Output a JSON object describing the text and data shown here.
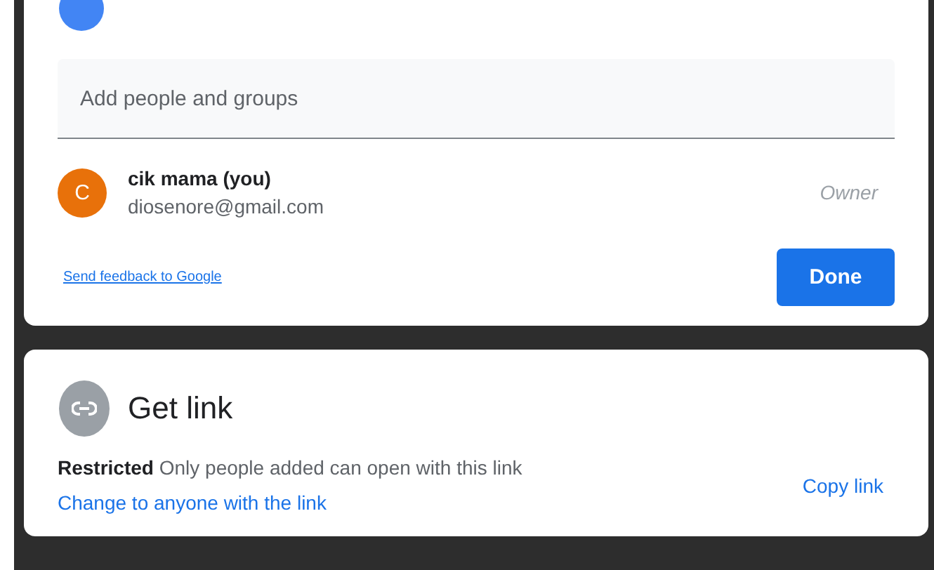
{
  "share_dialog": {
    "search": {
      "placeholder": "Add people and groups"
    },
    "people": [
      {
        "initial": "C",
        "name": "cik mama (you)",
        "email": "diosenore@gmail.com",
        "role": "Owner",
        "color": "#e8710a"
      }
    ],
    "feedback_link": "Send feedback to Google",
    "done_button": "Done"
  },
  "get_link": {
    "title": "Get link",
    "description": "**Restricted** Only people added can open with this link",
    "change_link": "Change to anyone with the link",
    "copy_link": "Copy link"
  }
}
